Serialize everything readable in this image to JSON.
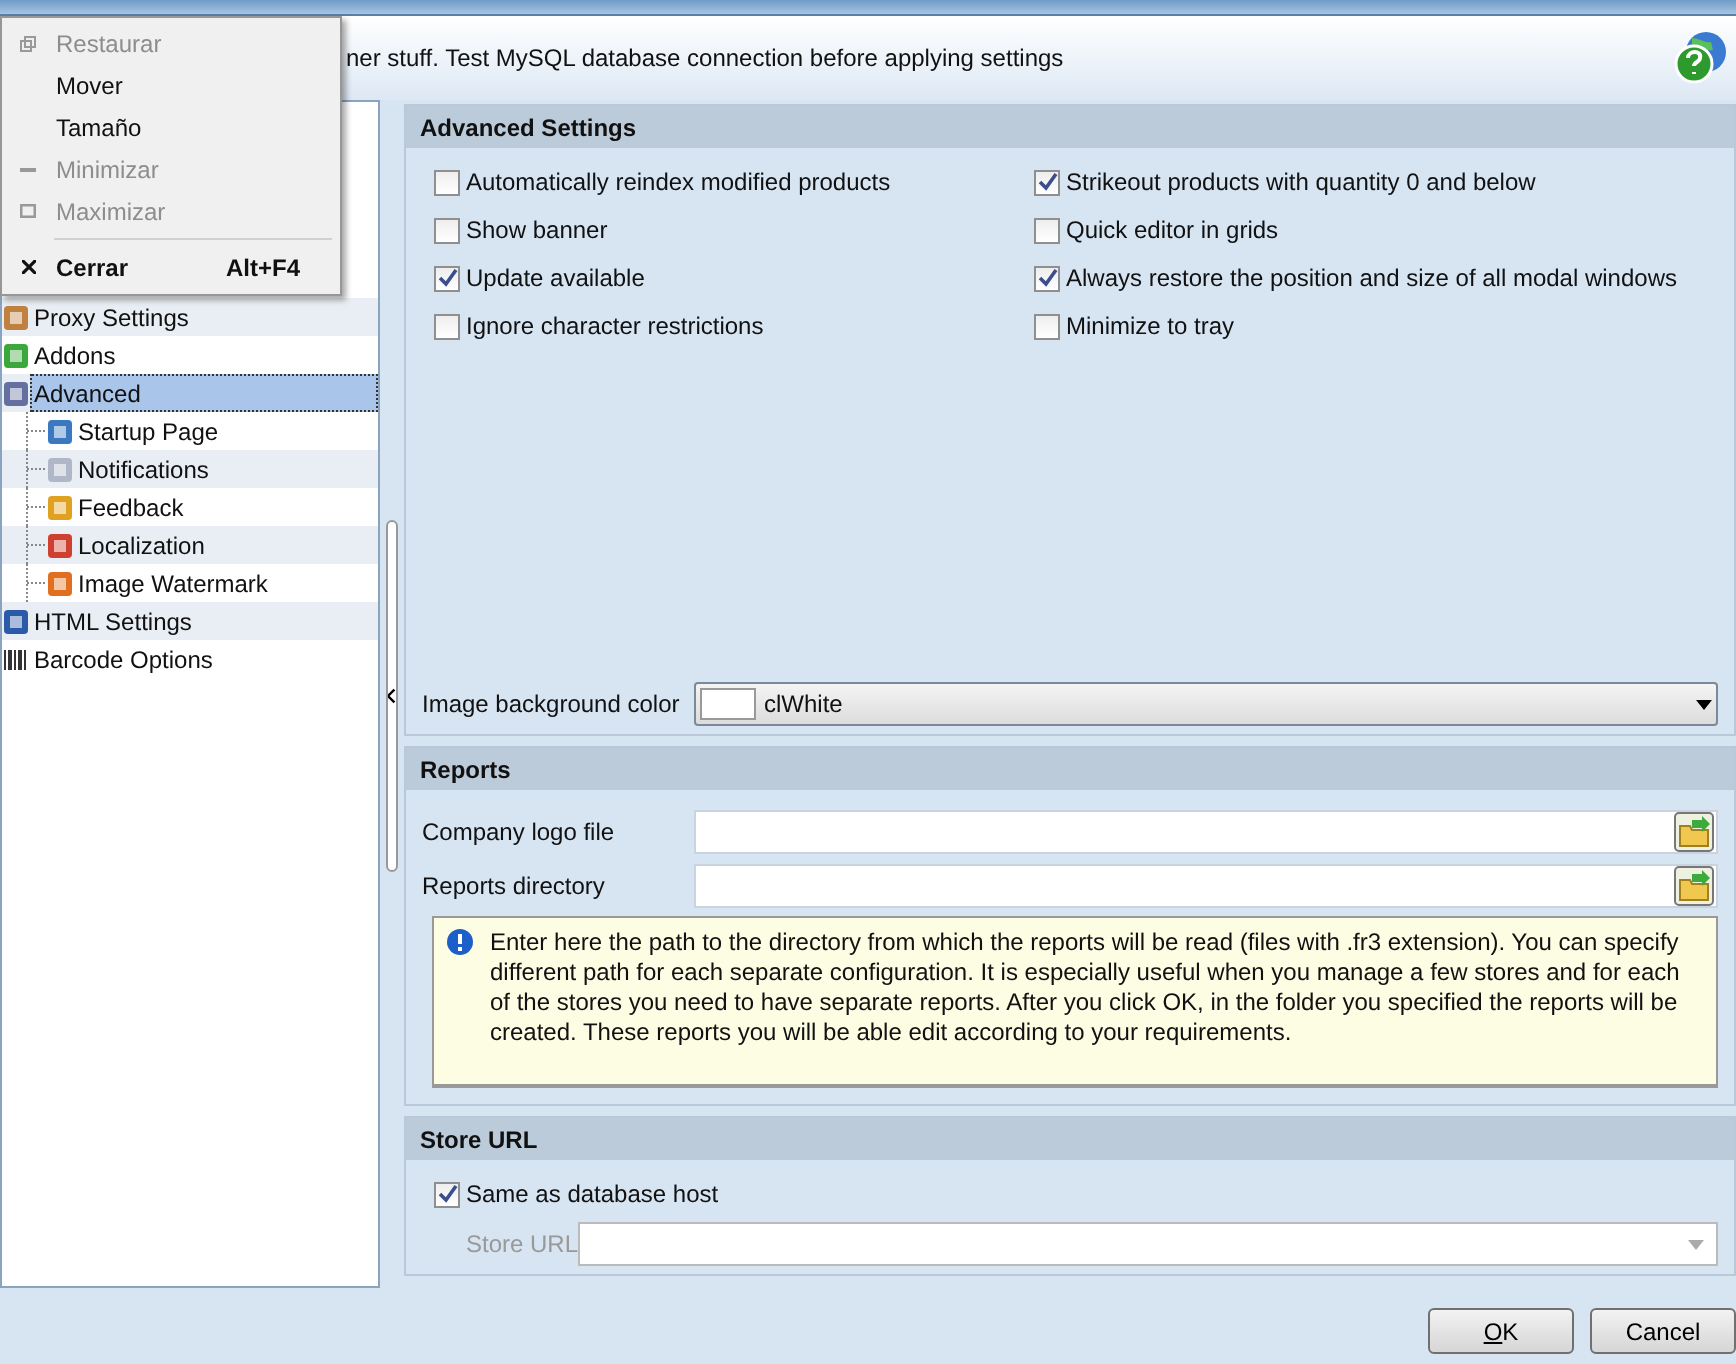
{
  "header": {
    "text": "ner stuff. Test MySQL database connection before applying settings"
  },
  "system_menu": {
    "items": [
      {
        "label": "Restaurar",
        "disabled": true
      },
      {
        "label": "Mover",
        "disabled": false
      },
      {
        "label": "Tamaño",
        "disabled": false
      },
      {
        "label": "Minimizar",
        "disabled": true
      },
      {
        "label": "Maximizar",
        "disabled": true,
        "separator_after": true
      },
      {
        "label": "Cerrar",
        "disabled": false,
        "shortcut": "Alt+F4",
        "bold": true
      }
    ]
  },
  "tree": {
    "items": [
      {
        "label": "Proxy Settings",
        "selected": false
      },
      {
        "label": "Addons",
        "selected": false
      },
      {
        "label": "Advanced",
        "selected": true,
        "children": [
          {
            "label": "Startup Page",
            "selected": false
          },
          {
            "label": "Notifications",
            "selected": false
          },
          {
            "label": "Feedback",
            "selected": false
          },
          {
            "label": "Localization",
            "selected": false
          },
          {
            "label": "Image Watermark",
            "selected": false
          }
        ]
      },
      {
        "label": "HTML Settings",
        "selected": false
      },
      {
        "label": "Barcode Options",
        "selected": false
      }
    ]
  },
  "advanced_settings": {
    "title": "Advanced Settings",
    "options": [
      {
        "label": "Automatically reindex modified products",
        "checked": false
      },
      {
        "label": "Strikeout products with quantity 0 and below",
        "checked": true
      },
      {
        "label": "Show banner",
        "checked": false
      },
      {
        "label": "Quick editor in grids",
        "checked": false
      },
      {
        "label": "Update available",
        "checked": true
      },
      {
        "label": "Always restore the position and size of all modal windows",
        "checked": true
      },
      {
        "label": "Ignore character restrictions",
        "checked": false
      },
      {
        "label": "Minimize to tray",
        "checked": false
      }
    ],
    "image_background_color": {
      "label": "Image background color",
      "value": "clWhite",
      "color": "#ffffff"
    }
  },
  "reports": {
    "title": "Reports",
    "fields": [
      {
        "label": "Company logo file"
      },
      {
        "label": "Reports directory"
      }
    ],
    "info": "Enter here the path to the directory from which the reports will be read (files with .fr3 extension). You can specify different path for each separate configuration. It is especially useful when you manage a few stores and for each of the stores you need to have separate reports. After you click OK, in the folder you specified the reports will be created. These reports you will be able edit according to your requirements."
  },
  "store_url": {
    "title": "Store URL",
    "same_as_host": {
      "label": "Same as database host",
      "checked": true
    },
    "url_field": {
      "label": "Store URL",
      "disabled": true
    }
  },
  "buttons": [
    {
      "label": "OK",
      "accelerator_underlined": true
    },
    {
      "label": "Cancel",
      "accelerator_underlined": false
    }
  ]
}
